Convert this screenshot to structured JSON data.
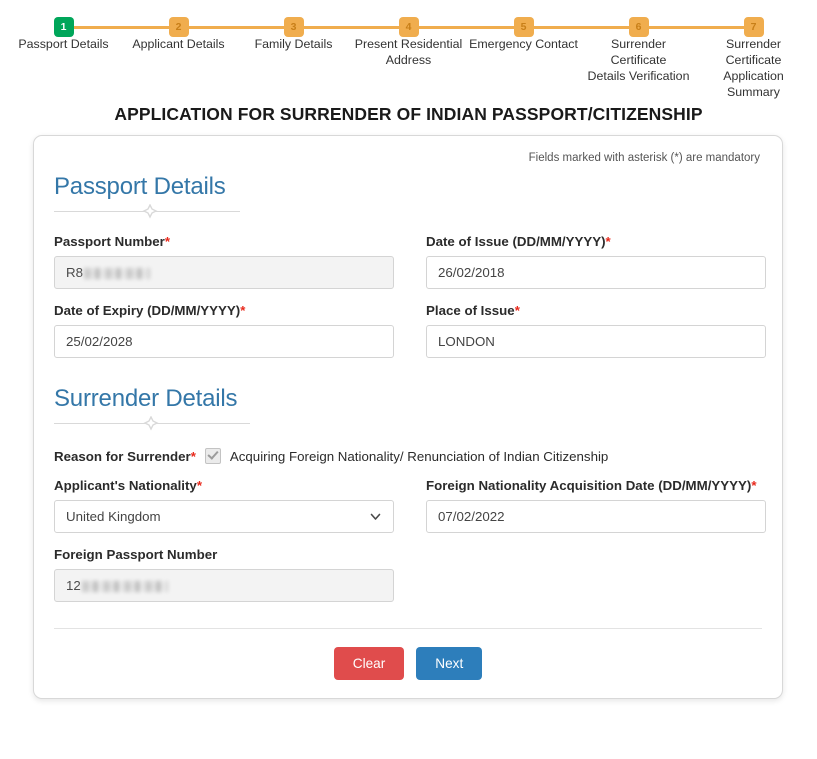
{
  "stepper": {
    "steps": [
      {
        "number": "1",
        "label": "Passport Details",
        "state": "done"
      },
      {
        "number": "2",
        "label": "Applicant Details",
        "state": "pending"
      },
      {
        "number": "3",
        "label": "Family Details",
        "state": "pending"
      },
      {
        "number": "4",
        "label": "Present Residential\nAddress",
        "state": "pending"
      },
      {
        "number": "5",
        "label": "Emergency Contact",
        "state": "pending"
      },
      {
        "number": "6",
        "label": "Surrender Certificate\nDetails Verification",
        "state": "pending"
      },
      {
        "number": "7",
        "label": "Surrender Certificate\nApplication Summary",
        "state": "pending"
      }
    ],
    "colors": {
      "done": "#00a65a",
      "pending": "#f0ad4e",
      "line": "#f0ad4e"
    }
  },
  "page_title": "APPLICATION FOR SURRENDER OF INDIAN PASSPORT/CITIZENSHIP",
  "card": {
    "mandatory_note": "Fields marked with asterisk (*) are mandatory",
    "sections": [
      {
        "id": "passport",
        "title": "Passport Details"
      },
      {
        "id": "surrender",
        "title": "Surrender Details"
      }
    ],
    "fields": {
      "passport_number": {
        "label": "Passport Number",
        "required": "*",
        "value": "R8",
        "redacted": true
      },
      "date_of_issue": {
        "label": "Date of Issue (DD/MM/YYYY)",
        "required": "*",
        "value": "26/02/2018"
      },
      "date_of_expiry": {
        "label": "Date of Expiry (DD/MM/YYYY)",
        "required": "*",
        "value": "25/02/2028"
      },
      "place_of_issue": {
        "label": "Place of Issue",
        "required": "*",
        "value": "LONDON"
      },
      "reason_for_surrender": {
        "label": "Reason for Surrender",
        "required": "*",
        "option_label": "Acquiring Foreign Nationality/ Renunciation of Indian Citizenship",
        "checked": true,
        "disabled": true
      },
      "applicant_nationality": {
        "label": "Applicant's Nationality",
        "required": "*",
        "value": "United Kingdom"
      },
      "foreign_nationality_date": {
        "label": "Foreign Nationality Acquisition Date (DD/MM/YYYY)",
        "required": "*",
        "value": "07/02/2022"
      },
      "foreign_passport_number": {
        "label": "Foreign Passport Number",
        "required": "",
        "value": "12",
        "redacted": true
      }
    },
    "buttons": {
      "clear": {
        "label": "Clear",
        "color": "#e04c4c"
      },
      "next": {
        "label": "Next",
        "color": "#2d7ebb"
      }
    }
  }
}
